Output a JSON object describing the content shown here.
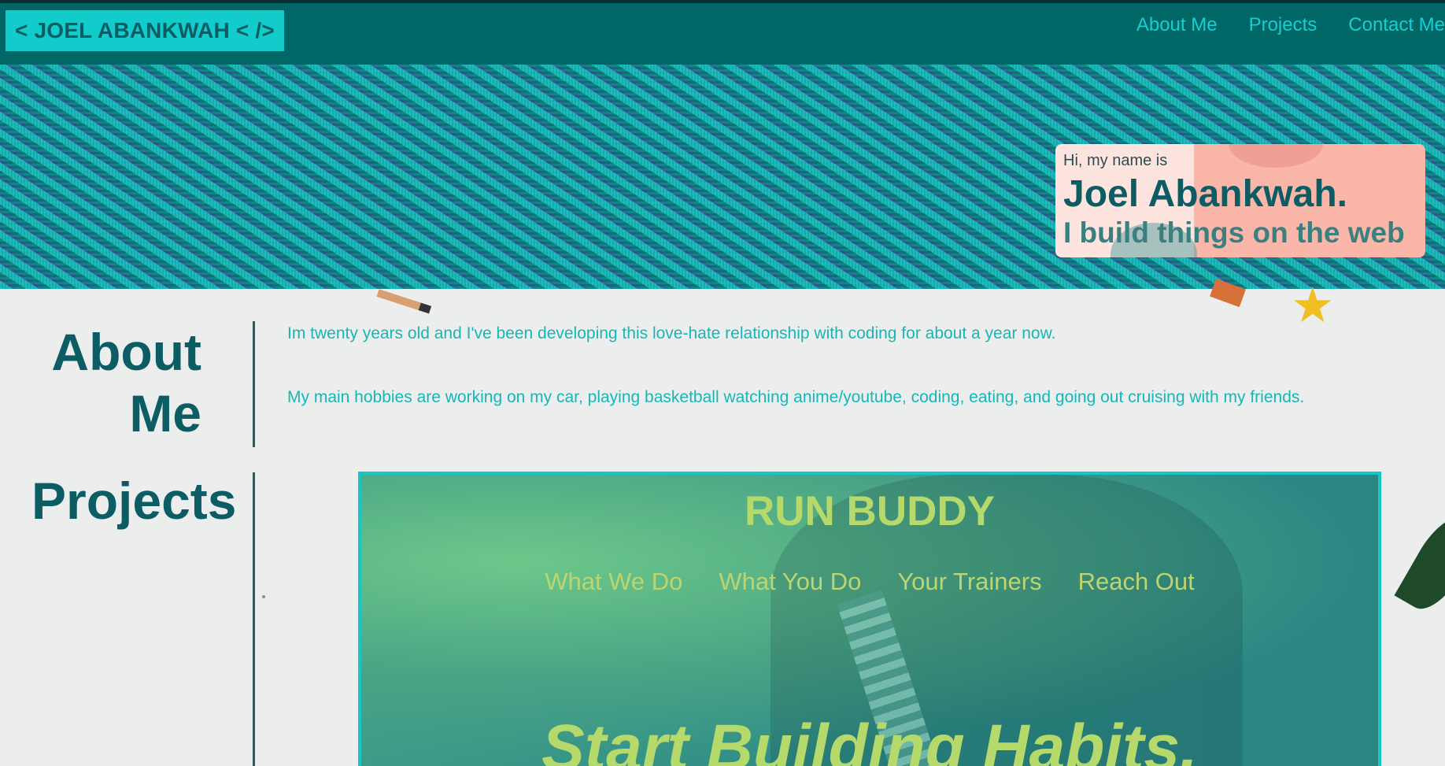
{
  "header": {
    "logo": "< JOEL ABANKWAH < />",
    "nav": [
      "About Me",
      "Projects",
      "Contact Me"
    ]
  },
  "intro": {
    "greeting": "Hi, my name is",
    "name": "Joel Abankwah.",
    "tagline": "I build things on the web"
  },
  "about": {
    "title_line1": "About",
    "title_line2": "Me",
    "paragraphs": [
      "Im twenty years old and I've been developing this love-hate relationship with coding for about a year now.",
      "My main hobbies are working on my car, playing basketball watching anime/youtube, coding, eating, and going out cruising with my friends."
    ]
  },
  "projects": {
    "title": "Projects",
    "card": {
      "title": "RUN BUDDY",
      "nav": [
        "What We Do",
        "What You Do",
        "Your Trainers",
        "Reach Out"
      ],
      "headline": "Start Building Habits."
    }
  },
  "colors": {
    "header_bg": "#006666",
    "logo_bg": "#12cccc",
    "accent": "#17b6b6",
    "heading": "#0b5c63"
  }
}
